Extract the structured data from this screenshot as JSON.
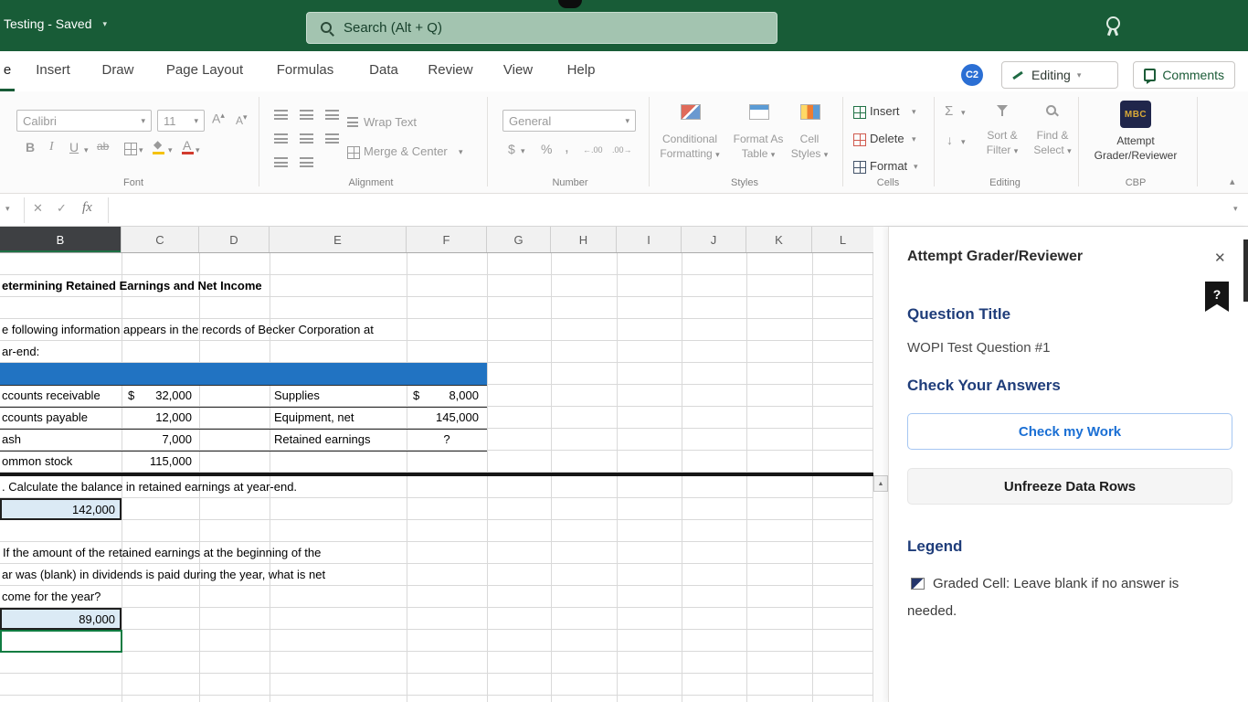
{
  "titlebar": {
    "title": "Testing - Saved",
    "search_placeholder": "Search (Alt + Q)"
  },
  "tabs": {
    "cut": "e",
    "items": [
      "Insert",
      "Draw",
      "Page Layout",
      "Formulas",
      "Data",
      "Review",
      "View",
      "Help"
    ],
    "avatar": "C2",
    "editing_label": "Editing",
    "comments_label": "Comments"
  },
  "ribbon": {
    "font": {
      "name": "Calibri",
      "size": "11",
      "label": "Font"
    },
    "alignment": {
      "wrap": "Wrap Text",
      "merge": "Merge & Center",
      "label": "Alignment"
    },
    "number": {
      "format": "General",
      "label": "Number"
    },
    "styles": {
      "cf1": "Conditional",
      "cf2": "Formatting",
      "fat1": "Format As",
      "fat2": "Table",
      "cs1": "Cell",
      "cs2": "Styles",
      "label": "Styles"
    },
    "cells": {
      "insert": "Insert",
      "delete": "Delete",
      "format": "Format",
      "label": "Cells"
    },
    "editing": {
      "sort1": "Sort &",
      "sort2": "Filter",
      "find1": "Find &",
      "find2": "Select",
      "label": "Editing"
    },
    "cbp": {
      "logo": "MBC",
      "line1": "Attempt",
      "line2": "Grader/Reviewer",
      "label": "CBP"
    }
  },
  "sheet": {
    "columns": [
      "B",
      "C",
      "D",
      "E",
      "F",
      "G",
      "H",
      "I",
      "J",
      "K",
      "L"
    ],
    "title": "etermining Retained Earnings and Net Income",
    "para1": "e following information appears in the records of Becker Corporation at",
    "para2": "ar-end:",
    "rows": [
      {
        "label": "ccounts receivable",
        "sym": "$",
        "val": "32,000",
        "label2": "Supplies",
        "sym2": "$",
        "val2": "8,000"
      },
      {
        "label": "ccounts payable",
        "val": "12,000",
        "label2": "Equipment, net",
        "val2": "145,000"
      },
      {
        "label": "ash",
        "val": "7,000",
        "label2": "Retained earnings",
        "val2": "?"
      },
      {
        "label": "ommon stock",
        "val": "115,000"
      }
    ],
    "q1": ". Calculate the balance in retained earnings at year-end.",
    "a1": "142,000",
    "q2a": "If the amount of the retained earnings at the beginning of the",
    "q2b": "ar was (blank) in dividends is paid during the year, what is net",
    "q2c": "come for the year?",
    "a2": "89,000"
  },
  "pane": {
    "title": "Attempt Grader/Reviewer",
    "help": "?",
    "h1": "Question Title",
    "question": "WOPI Test Question #1",
    "h2": "Check Your Answers",
    "check_btn": "Check my Work",
    "unfreeze_btn": "Unfreeze Data Rows",
    "h3": "Legend",
    "legend1": "Graded Cell: Leave blank if no answer is",
    "legend2": "needed."
  },
  "icons": {
    "chevron_down": "▾",
    "chevron_up": "▴",
    "close": "✕",
    "cancel": "✕",
    "check": "✓",
    "fx": "fx",
    "sigma": "Σ",
    "bold": "B",
    "italic": "I",
    "underline": "U",
    "strike": "ab",
    "letter_a": "A",
    "dollar": "$",
    "percent": "%",
    "comma": ",",
    "inc_dec": "←.00",
    "dec_dec": ".00→",
    "fill_arrow": "↓",
    "diamond": "◆",
    "up_arrow": "▲"
  },
  "colors": {
    "accent_green": "#185C37",
    "band_blue": "#2173C2",
    "cell_fill": "#DBEAF5",
    "heading_blue": "#1F3D7A",
    "link_blue": "#1A6FD4"
  }
}
